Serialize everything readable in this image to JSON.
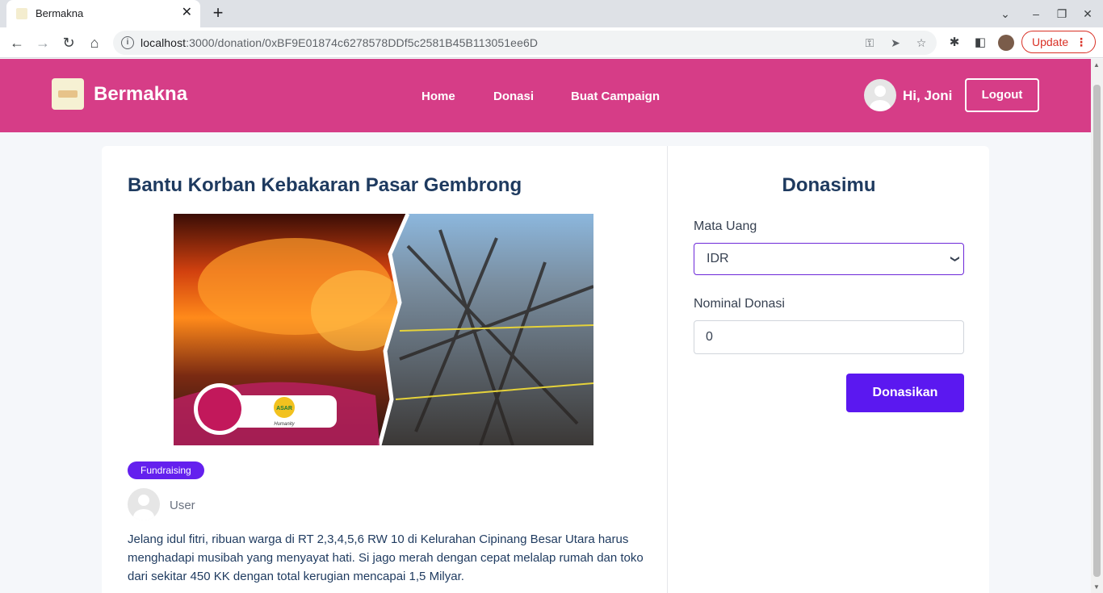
{
  "browser": {
    "tab_title": "Bermakna",
    "tab_close": "✕",
    "new_tab": "+",
    "url_host": "localhost",
    "url_path": ":3000/donation/0xBF9E01874c6278578DDf5c2581B45B113051ee6D",
    "update_label": "Update",
    "update_menu": "⋮"
  },
  "header": {
    "brand": "Bermakna",
    "nav": [
      "Home",
      "Donasi",
      "Buat Campaign"
    ],
    "greeting": "Hi, Joni",
    "logout": "Logout"
  },
  "campaign": {
    "title": "Bantu Korban Kebakaran Pasar Gembrong",
    "category": "Fundraising",
    "author": "User",
    "description": "Jelang idul fitri, ribuan warga di RT 2,3,4,5,6 RW 10 di Kelurahan Cipinang Besar Utara harus menghadapi musibah yang menyayat hati. Si jago merah dengan cepat melalap rumah dan toko dari sekitar 450 KK dengan total kerugian mencapai 1,5 Milyar.",
    "image_badge_text": "ASAR",
    "image_badge_subtext": "Humanity"
  },
  "donation": {
    "title": "Donasimu",
    "currency_label": "Mata Uang",
    "currency_value": "IDR",
    "amount_label": "Nominal Donasi",
    "amount_value": "0",
    "submit": "Donasikan"
  },
  "colors": {
    "header": "#d63d87",
    "primary": "#5b18f0",
    "title": "#1e3a5f"
  }
}
